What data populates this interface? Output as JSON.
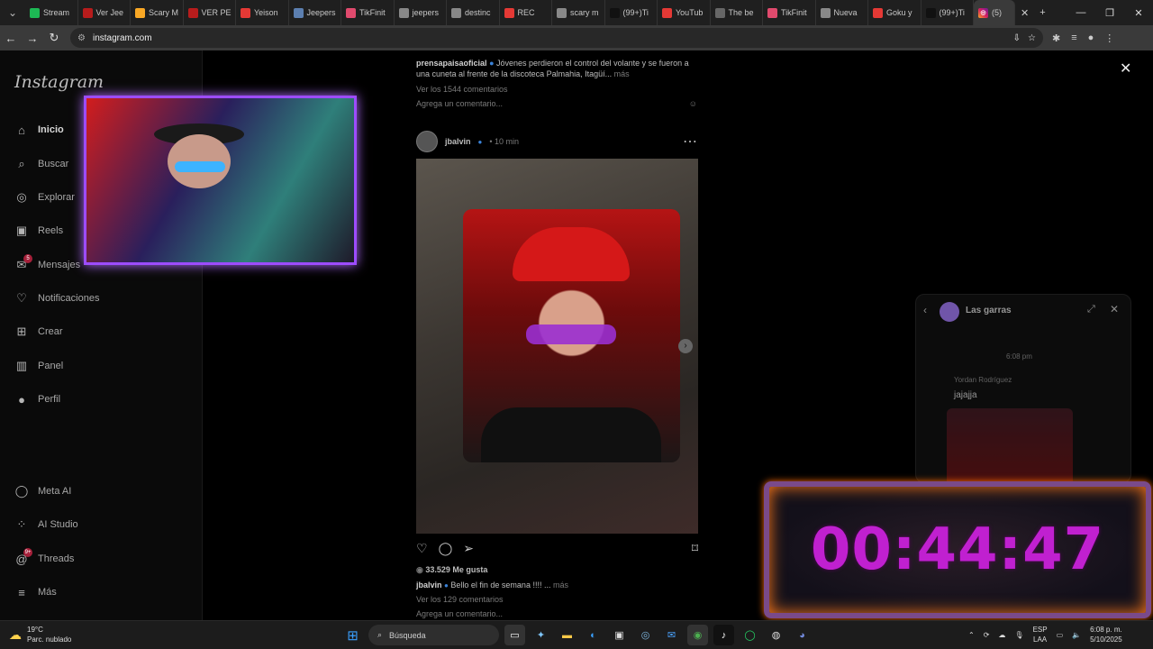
{
  "browser": {
    "tabs": [
      {
        "title": "Stream",
        "color": "#1db954"
      },
      {
        "title": "Ver Jee",
        "color": "#b71c1c"
      },
      {
        "title": "Scary M",
        "color": "#f9a825"
      },
      {
        "title": "VER PE",
        "color": "#b71c1c"
      },
      {
        "title": "Yeison",
        "color": "#e53935"
      },
      {
        "title": "Jeepers",
        "color": "#5c7fb0"
      },
      {
        "title": "TikFinit",
        "color": "#e04a6d"
      },
      {
        "title": "jeepers",
        "color": "#888"
      },
      {
        "title": "destinc",
        "color": "#888"
      },
      {
        "title": "REC",
        "color": "#e53935"
      },
      {
        "title": "scary m",
        "color": "#888"
      },
      {
        "title": "(99+)Ti",
        "color": "#111"
      },
      {
        "title": "YouTub",
        "color": "#e53935"
      },
      {
        "title": "The be",
        "color": "#666"
      },
      {
        "title": "TikFinit",
        "color": "#e04a6d"
      },
      {
        "title": "Nueva",
        "color": "#888"
      },
      {
        "title": "Goku y",
        "color": "#e53935"
      },
      {
        "title": "(99+)Ti",
        "color": "#111"
      }
    ],
    "active_tab": "(5)",
    "url": "instagram.com"
  },
  "sidebar": {
    "logo": "Instagram",
    "items": [
      {
        "label": "Inicio",
        "icon": "home-icon"
      },
      {
        "label": "Buscar",
        "icon": "search-icon"
      },
      {
        "label": "Explorar",
        "icon": "compass-icon"
      },
      {
        "label": "Reels",
        "icon": "reels-icon"
      },
      {
        "label": "Mensajes",
        "icon": "messenger-icon",
        "badge": "5"
      },
      {
        "label": "Notificaciones",
        "icon": "heart-icon"
      },
      {
        "label": "Crear",
        "icon": "plus-icon"
      },
      {
        "label": "Panel",
        "icon": "chart-icon"
      },
      {
        "label": "Perfil",
        "icon": "avatar-icon"
      }
    ],
    "bottom": [
      {
        "label": "Meta AI",
        "icon": "meta-ai-icon"
      },
      {
        "label": "AI Studio",
        "icon": "ai-studio-icon"
      },
      {
        "label": "Threads",
        "icon": "threads-icon",
        "badge": "9+"
      },
      {
        "label": "Más",
        "icon": "menu-icon"
      }
    ]
  },
  "feed": {
    "prev_post": {
      "user": "prensapaisaoficial",
      "caption": "Jóvenes perdieron el control del volante y se fueron a una cuneta al frente de la discoteca Palmahia, Itagüí...",
      "more": "más",
      "comments": "Ver los 1544 comentarios",
      "add_comment": "Agrega un comentario..."
    },
    "post": {
      "user": "jbalvin",
      "time": "10 min",
      "likes": "33.529 Me gusta",
      "caption": "Bello el fin de semana !!!! ...",
      "more": "más",
      "comments": "Ver los 129 comentarios",
      "add_comment": "Agrega un comentario..."
    }
  },
  "chat": {
    "title": "Las garras",
    "time": "6:08 pm",
    "sender": "Yordan Rodríguez",
    "message": "jajajja"
  },
  "overlay_timer": "00:44:47",
  "taskbar": {
    "temp": "19°C",
    "weather": "Parc. nublado",
    "search_placeholder": "Búsqueda",
    "lang1": "ESP",
    "lang2": "LAA",
    "time": "6:08 p. m.",
    "date": "5/10/2025"
  }
}
